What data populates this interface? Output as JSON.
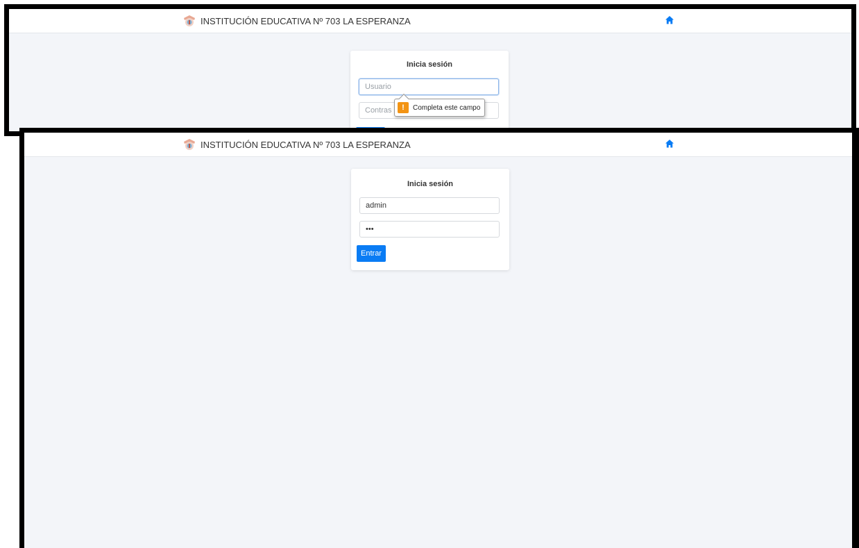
{
  "brand": {
    "logo_icon": "school-crest-icon",
    "title": "INSTITUCIÓN EDUCATIVA Nº 703 LA ESPERANZA"
  },
  "nav": {
    "home_icon": "home-icon",
    "accent_color": "#0a7cf4"
  },
  "screen_before": {
    "form_title": "Inicia sesión",
    "username_placeholder": "Usuario",
    "username_value": "",
    "password_placeholder": "Contraseña",
    "password_visible_text": "Contras",
    "validation_tooltip": {
      "icon": "warning-icon",
      "text": "Completa este campo"
    }
  },
  "screen_after": {
    "form_title": "Inicia sesión",
    "username_value": "admin",
    "password_value": "•••",
    "submit_label": "Entrar"
  },
  "colors": {
    "page_background": "#f3f5f9",
    "warning": "#f39414",
    "button": "#0a7cf4"
  }
}
